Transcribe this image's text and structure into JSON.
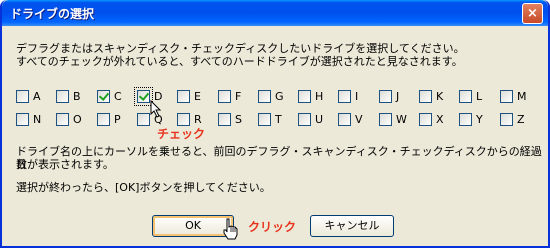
{
  "window": {
    "title": "ドライブの選択",
    "close_glyph": "×"
  },
  "instructions": {
    "line1": "デフラグまたはスキャンディスク・チェックディスクしたいドライブを選択してください。",
    "line2": "すべてのチェックが外れていると、すべてのハードドライブが選択されたと見なされます。",
    "line3": "ドライブ名の上にカーソルを乗せると、前回のデフラグ・スキャンディスク・チェックディスクからの経過日",
    "line4": "数が表示されます。",
    "line5": "選択が終わったら、[OK]ボタンを押してください。"
  },
  "drives": [
    {
      "label": "A",
      "checked": false
    },
    {
      "label": "B",
      "checked": false
    },
    {
      "label": "C",
      "checked": true
    },
    {
      "label": "D",
      "checked": true
    },
    {
      "label": "E",
      "checked": false
    },
    {
      "label": "F",
      "checked": false
    },
    {
      "label": "G",
      "checked": false
    },
    {
      "label": "H",
      "checked": false
    },
    {
      "label": "I",
      "checked": false
    },
    {
      "label": "J",
      "checked": false
    },
    {
      "label": "K",
      "checked": false
    },
    {
      "label": "L",
      "checked": false
    },
    {
      "label": "M",
      "checked": false
    },
    {
      "label": "N",
      "checked": false
    },
    {
      "label": "O",
      "checked": false
    },
    {
      "label": "P",
      "checked": false
    },
    {
      "label": "Q",
      "checked": false
    },
    {
      "label": "R",
      "checked": false
    },
    {
      "label": "S",
      "checked": false
    },
    {
      "label": "T",
      "checked": false
    },
    {
      "label": "U",
      "checked": false
    },
    {
      "label": "V",
      "checked": false
    },
    {
      "label": "W",
      "checked": false
    },
    {
      "label": "X",
      "checked": false
    },
    {
      "label": "Y",
      "checked": false
    },
    {
      "label": "Z",
      "checked": false
    }
  ],
  "annotations": {
    "check": "チェック",
    "click": "クリック"
  },
  "buttons": {
    "ok": "OK",
    "cancel": "キャンセル"
  },
  "colors": {
    "annotation": "#e8331c",
    "titlebar": "#0053ee",
    "check": "#21a121"
  }
}
